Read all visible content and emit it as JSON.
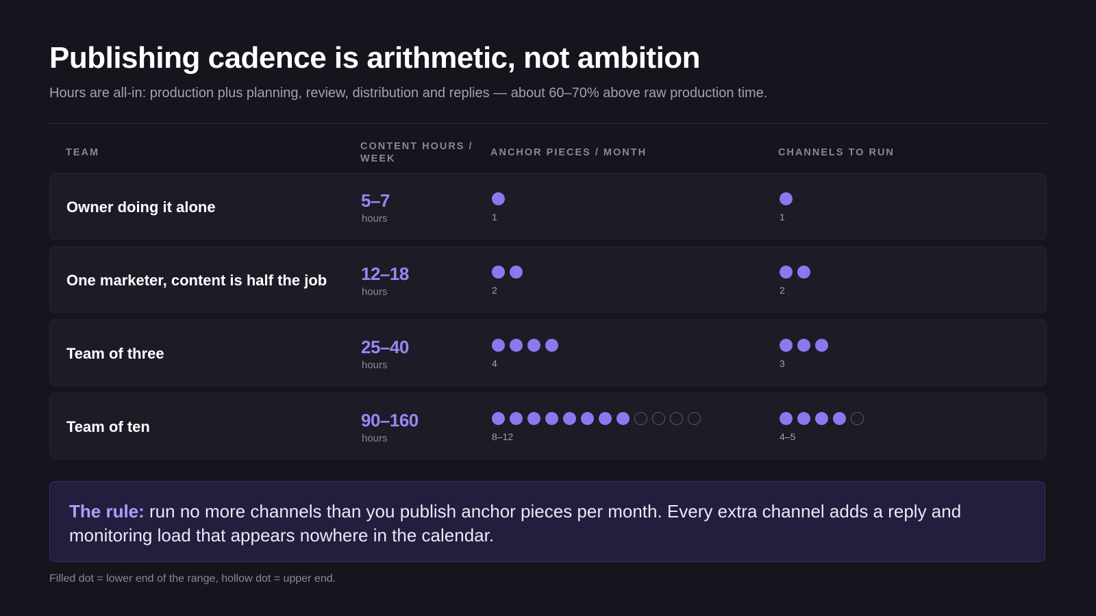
{
  "title": "Publishing cadence is arithmetic, not ambition",
  "subtitle": "Hours are all-in: production plus planning, review, distribution and replies — about 60–70% above raw production time.",
  "columns": {
    "team": "Team",
    "hours": "Content hours / week",
    "anchor": "Anchor pieces / month",
    "channels": "Channels to run"
  },
  "colors": {
    "filled_dot": "#8e77ee",
    "hollow_dot": "#5a566a",
    "accent": "#9a86f2",
    "background": "#16141c"
  },
  "rows": [
    {
      "team": "Owner doing it alone",
      "hours": "5–7",
      "hours_unit": "hours",
      "anchor": {
        "filled": 1,
        "hollow": 0,
        "label": "1"
      },
      "channels": {
        "filled": 1,
        "hollow": 0,
        "label": "1"
      }
    },
    {
      "team": "One marketer, content is half the job",
      "hours": "12–18",
      "hours_unit": "hours",
      "anchor": {
        "filled": 2,
        "hollow": 0,
        "label": "2"
      },
      "channels": {
        "filled": 2,
        "hollow": 0,
        "label": "2"
      }
    },
    {
      "team": "Team of three",
      "hours": "25–40",
      "hours_unit": "hours",
      "anchor": {
        "filled": 4,
        "hollow": 0,
        "label": "4"
      },
      "channels": {
        "filled": 3,
        "hollow": 0,
        "label": "3"
      }
    },
    {
      "team": "Team of ten",
      "hours": "90–160",
      "hours_unit": "hours",
      "anchor": {
        "filled": 8,
        "hollow": 4,
        "label": "8–12"
      },
      "channels": {
        "filled": 4,
        "hollow": 1,
        "label": "4–5"
      }
    }
  ],
  "rule": {
    "lead": "The rule:",
    "text": " run no more channels than you publish anchor pieces per month. Every extra channel adds a reply and monitoring load that appears nowhere in the calendar."
  },
  "footnote": "Filled dot = lower end of the range, hollow dot = upper end."
}
